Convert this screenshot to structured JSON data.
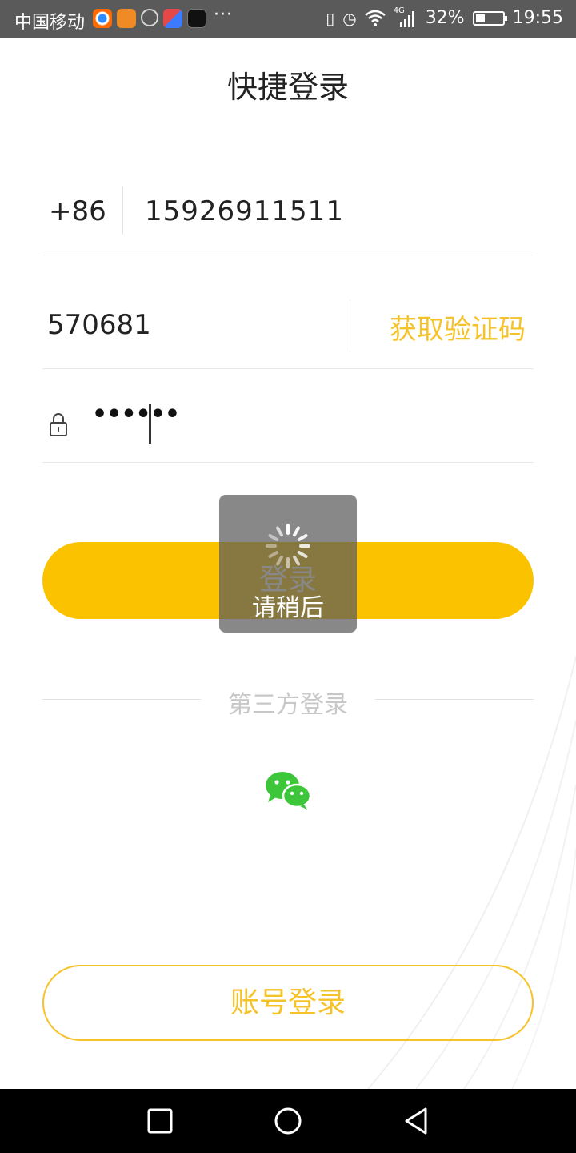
{
  "status_bar": {
    "carrier": "中国移动",
    "more": "···",
    "network": "4G",
    "battery": "32%",
    "time": "19:55"
  },
  "title": "快捷登录",
  "phone": {
    "country_code": "+86",
    "number": "15926911511"
  },
  "verification": {
    "code": "570681",
    "get_code_label": "获取验证码"
  },
  "password": {
    "masked": "••••••"
  },
  "login_button": "登录",
  "loading_text": "请稍后",
  "third_party_label": "第三方登录",
  "account_login_button": "账号登录",
  "colors": {
    "accent": "#fbc200",
    "accent_text": "#f6c22a",
    "wechat": "#3ec63a"
  },
  "icons": {
    "lock": "lock-icon",
    "wechat": "wechat-icon",
    "recent": "square-icon",
    "home": "circle-icon",
    "back": "triangle-back-icon"
  }
}
